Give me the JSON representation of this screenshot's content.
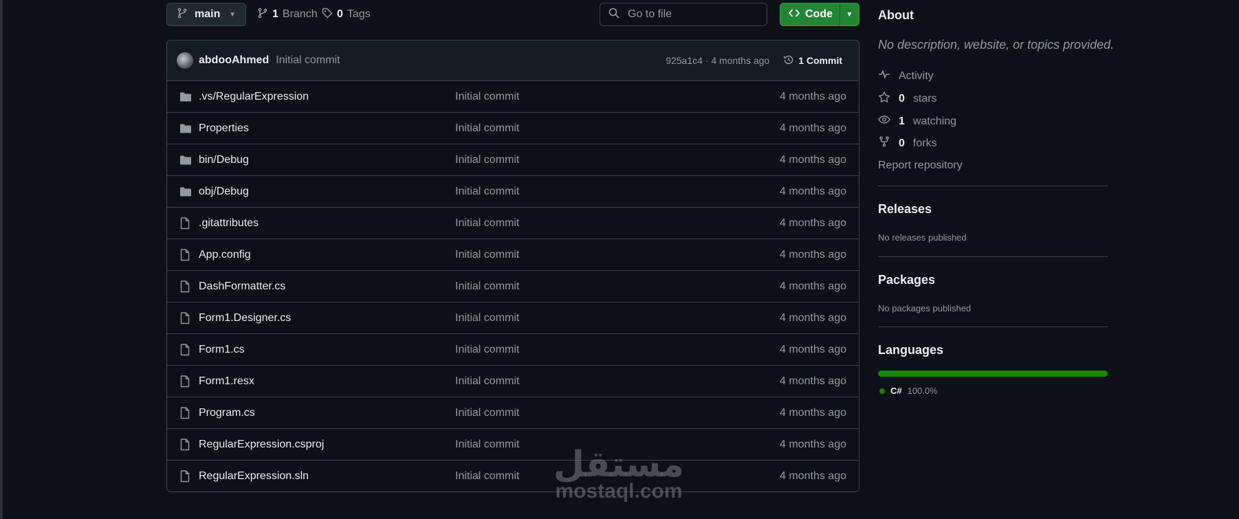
{
  "repo_nav": {
    "branch": "main",
    "branches_count": "1",
    "branches_label": "Branch",
    "tags_count": "0",
    "tags_label": "Tags",
    "goto_placeholder": "Go to file",
    "code_label": "Code"
  },
  "latest_commit": {
    "author": "abdooAhmed",
    "message": "Initial commit",
    "hash_time": "925a1c4 · 4 months ago",
    "commits_label": "1 Commit"
  },
  "files": [
    {
      "name": ".vs/RegularExpression",
      "type": "folder",
      "message": "Initial commit",
      "date": "4 months ago"
    },
    {
      "name": "Properties",
      "type": "folder",
      "message": "Initial commit",
      "date": "4 months ago"
    },
    {
      "name": "bin/Debug",
      "type": "folder",
      "message": "Initial commit",
      "date": "4 months ago"
    },
    {
      "name": "obj/Debug",
      "type": "folder",
      "message": "Initial commit",
      "date": "4 months ago"
    },
    {
      "name": ".gitattributes",
      "type": "file",
      "message": "Initial commit",
      "date": "4 months ago"
    },
    {
      "name": "App.config",
      "type": "file",
      "message": "Initial commit",
      "date": "4 months ago"
    },
    {
      "name": "DashFormatter.cs",
      "type": "file",
      "message": "Initial commit",
      "date": "4 months ago"
    },
    {
      "name": "Form1.Designer.cs",
      "type": "file",
      "message": "Initial commit",
      "date": "4 months ago"
    },
    {
      "name": "Form1.cs",
      "type": "file",
      "message": "Initial commit",
      "date": "4 months ago"
    },
    {
      "name": "Form1.resx",
      "type": "file",
      "message": "Initial commit",
      "date": "4 months ago"
    },
    {
      "name": "Program.cs",
      "type": "file",
      "message": "Initial commit",
      "date": "4 months ago"
    },
    {
      "name": "RegularExpression.csproj",
      "type": "file",
      "message": "Initial commit",
      "date": "4 months ago"
    },
    {
      "name": "RegularExpression.sln",
      "type": "file",
      "message": "Initial commit",
      "date": "4 months ago"
    }
  ],
  "about": {
    "title": "About",
    "description": "No description, website, or topics provided.",
    "activity": "Activity",
    "stars_count": "0",
    "stars_label": "stars",
    "watching_count": "1",
    "watching_label": "watching",
    "forks_count": "0",
    "forks_label": "forks",
    "report": "Report repository"
  },
  "releases": {
    "title": "Releases",
    "text": "No releases published"
  },
  "packages": {
    "title": "Packages",
    "text": "No packages published"
  },
  "languages": {
    "title": "Languages",
    "items": [
      {
        "name": "C#",
        "percent": "100.0%",
        "fraction": 1.0,
        "color": "#178600"
      }
    ]
  },
  "watermark": {
    "arabic": "مستقل",
    "latin": "mostaql.com"
  },
  "colors": {
    "accent_green": "#238636",
    "background": "#0d1117"
  }
}
